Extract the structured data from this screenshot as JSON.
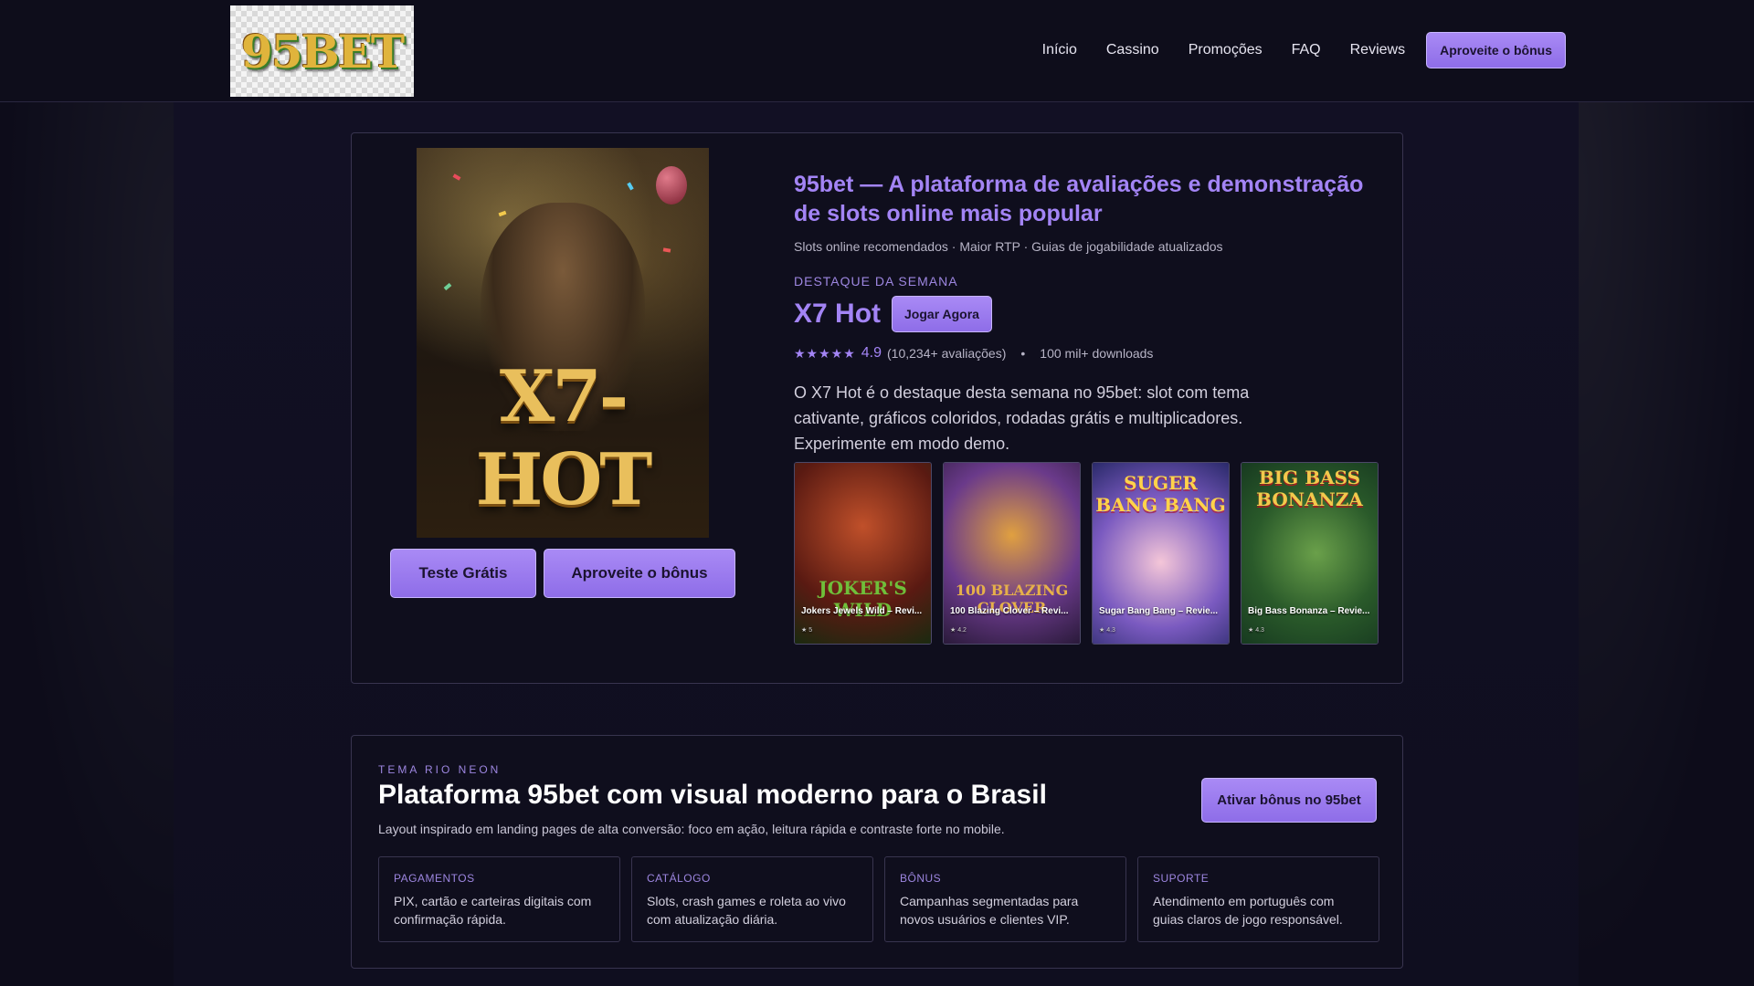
{
  "header": {
    "logo_text": "95BET",
    "nav": [
      "Início",
      "Cassino",
      "Promoções",
      "FAQ",
      "Reviews"
    ],
    "cta": "Aproveite o bônus"
  },
  "hero": {
    "art_title": "X7-HOT",
    "btn_test": "Teste Grátis",
    "btn_bonus": "Aproveite o bônus",
    "title": "95bet — A plataforma de avaliações e demonstração de slots online mais popular",
    "subtitle": "Slots online recomendados · Maior RTP · Guias de jogabilidade atualizados",
    "kicker": "DESTAQUE DA SEMANA",
    "featured_name": "X7 Hot",
    "featured_btn": "Jogar Agora",
    "stars": "★★★★★",
    "rating": "4.9",
    "rating_count": "(10,234+ avaliações)",
    "bullet": "•",
    "downloads": "100 mil+ downloads",
    "description": "O X7 Hot é o destaque desta semana no 95bet: slot com tema cativante, gráficos coloridos, rodadas grátis e multiplicadores. Experimente em modo demo."
  },
  "thumbs": [
    {
      "title": "Jokers Jewels Wild – Revi...",
      "rating": "★ 5",
      "art": "JOKER'S WILD",
      "color": "#8a2a1a"
    },
    {
      "title": "100 Blazing Clover – Revi...",
      "rating": "★ 4.2",
      "art": "100 BLAZING CLOVER",
      "color": "#4a2a6a"
    },
    {
      "title": "Sugar Bang Bang – Revie...",
      "rating": "★ 4.3",
      "art": "SUGER BANG BANG",
      "color": "#3a3a8a"
    },
    {
      "title": "Big Bass Bonanza – Revie...",
      "rating": "★ 4.3",
      "art": "BIG BASS BONANZA",
      "color": "#2a5a2a"
    }
  ],
  "section": {
    "kicker": "TEMA RIO NEON",
    "title": "Plataforma 95bet com visual moderno para o Brasil",
    "subtitle": "Layout inspirado em landing pages de alta conversão: foco em ação, leitura rápida e contraste forte no mobile.",
    "cta": "Ativar bônus no 95bet",
    "cards": [
      {
        "label": "PAGAMENTOS",
        "text": "PIX, cartão e carteiras digitais com confirmação rápida."
      },
      {
        "label": "CATÁLOGO",
        "text": "Slots, crash games e roleta ao vivo com atualização diária."
      },
      {
        "label": "BÔNUS",
        "text": "Campanhas segmentadas para novos usuários e clientes VIP."
      },
      {
        "label": "SUPORTE",
        "text": "Atendimento em português com guias claros de jogo responsável."
      }
    ]
  },
  "colors": {
    "accent": "#a384f5",
    "background": "#0d0c1a",
    "button": "#9b7bee"
  }
}
